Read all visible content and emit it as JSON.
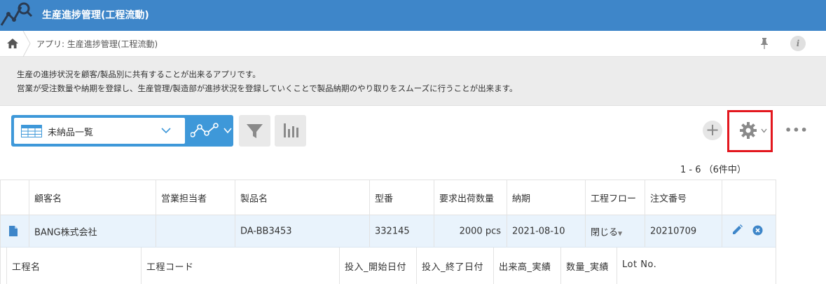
{
  "header": {
    "title": "生産進捗管理(工程流動)"
  },
  "breadcrumb": {
    "text": "アプリ: 生産進捗管理(工程流動)"
  },
  "info": {
    "label": "i"
  },
  "description": {
    "line1": "生産の進捗状況を顧客/製品別に共有することが出来るアプリです。",
    "line2": "営業が受注数量や納期を登録し、生産管理/製造部が進捗状況を登録していくことで製品納期のやり取りをスムーズに行うことが出来ます。"
  },
  "toolbar": {
    "view_label": "未納品一覧",
    "add_label": "+",
    "more_label": "•••",
    "pagination": "1 - 6 （6件中）"
  },
  "table": {
    "columns": [
      "顧客名",
      "営業担当者",
      "製品名",
      "型番",
      "要求出荷数量",
      "納期",
      "工程フロー",
      "注文番号"
    ],
    "row": {
      "customer": "BANG株式会社",
      "sales_rep": "",
      "product": "DA-BB3453",
      "model": "332145",
      "quantity": "2000 pcs",
      "due_date": "2021-08-10",
      "flow": "閉じる",
      "order_no": "20210709"
    },
    "sub_columns": [
      "工程名",
      "工程コード",
      "投入_開始日付",
      "投入_終了日付",
      "出来高_実績",
      "数量_実績",
      "Lot No."
    ]
  },
  "colors": {
    "header": "#3e86c9",
    "view_selector": "#3e98d9",
    "highlight": "#e3171e",
    "row_selected": "#e9f3fc"
  }
}
